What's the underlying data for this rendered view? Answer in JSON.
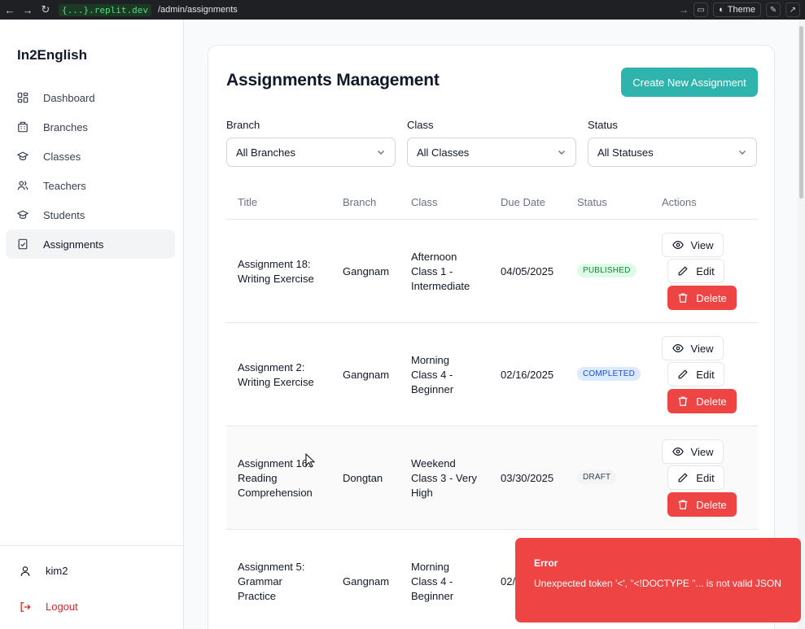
{
  "browser": {
    "domain": "{...}.replit.dev",
    "path": "/admin/assignments",
    "theme_label": "Theme"
  },
  "sidebar": {
    "brand": "In2English",
    "items": [
      {
        "label": "Dashboard",
        "icon": "dashboard-icon"
      },
      {
        "label": "Branches",
        "icon": "building-icon"
      },
      {
        "label": "Classes",
        "icon": "graduation-cap-icon"
      },
      {
        "label": "Teachers",
        "icon": "users-icon"
      },
      {
        "label": "Students",
        "icon": "graduation-cap-icon"
      },
      {
        "label": "Assignments",
        "icon": "clipboard-check-icon",
        "active": true
      }
    ],
    "user": "kim2",
    "logout": "Logout"
  },
  "main": {
    "title": "Assignments Management",
    "create_button": "Create New Assignment",
    "filters": [
      {
        "label": "Branch",
        "value": "All Branches"
      },
      {
        "label": "Class",
        "value": "All Classes"
      },
      {
        "label": "Status",
        "value": "All Statuses"
      }
    ],
    "columns": [
      "Title",
      "Branch",
      "Class",
      "Due Date",
      "Status",
      "Actions"
    ],
    "rows": [
      {
        "title_1": "Assignment 18:",
        "title_2": "Writing Exercise",
        "title_3": "",
        "branch": "Gangnam",
        "class_1": "Afternoon",
        "class_2": "Class 1 -",
        "class_3": "Intermediate",
        "due": "04/05/2025",
        "status": "PUBLISHED"
      },
      {
        "title_1": "Assignment 2:",
        "title_2": "Writing Exercise",
        "title_3": "",
        "branch": "Gangnam",
        "class_1": "Morning",
        "class_2": "Class 4 -",
        "class_3": "Beginner",
        "due": "02/16/2025",
        "status": "COMPLETED"
      },
      {
        "title_1": "Assignment 16:",
        "title_2": "Reading",
        "title_3": "Comprehension",
        "branch": "Dongtan",
        "class_1": "Weekend",
        "class_2": "Class 3 - Very",
        "class_3": "High",
        "due": "03/30/2025",
        "status": "DRAFT"
      },
      {
        "title_1": "Assignment 5:",
        "title_2": "Grammar",
        "title_3": "Practice",
        "branch": "Gangnam",
        "class_1": "Morning",
        "class_2": "Class 4 -",
        "class_3": "Beginner",
        "due": "02/",
        "status": ""
      }
    ],
    "actions": {
      "view": "View",
      "edit": "Edit",
      "delete": "Delete"
    }
  },
  "toast": {
    "title": "Error",
    "message": "Unexpected token '<', \"<!DOCTYPE \"... is not valid JSON"
  }
}
